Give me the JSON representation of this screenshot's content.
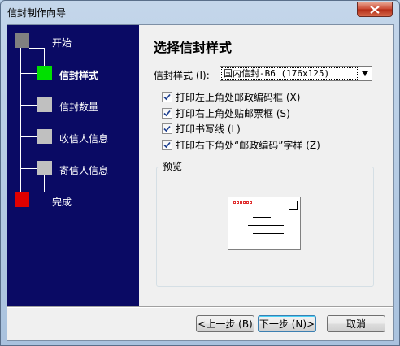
{
  "window": {
    "title": "信封制作向导"
  },
  "steps": [
    {
      "label": "开始",
      "color": "#808080"
    },
    {
      "label": "信封样式",
      "color": "#00e000",
      "current": true
    },
    {
      "label": "信封数量",
      "color": "#c0c0c0"
    },
    {
      "label": "收信人信息",
      "color": "#c0c0c0"
    },
    {
      "label": "寄信人信息",
      "color": "#c0c0c0"
    },
    {
      "label": "完成",
      "color": "#e00000"
    }
  ],
  "main": {
    "heading": "选择信封样式",
    "style_label": "信封样式 (I):",
    "style_value": "国内信封-B6 (176x125)",
    "options": [
      {
        "label": "打印左上角处邮政编码框 (X)",
        "checked": true
      },
      {
        "label": "打印右上角处贴邮票框 (S)",
        "checked": true
      },
      {
        "label": "打印书写线 (L)",
        "checked": true
      },
      {
        "label": "打印右下角处“邮政编码”字样 (Z)",
        "checked": true
      }
    ],
    "preview_label": "预览"
  },
  "buttons": {
    "back": "<上一步 (B)",
    "next": "下一步 (N)>",
    "cancel": "取消"
  }
}
